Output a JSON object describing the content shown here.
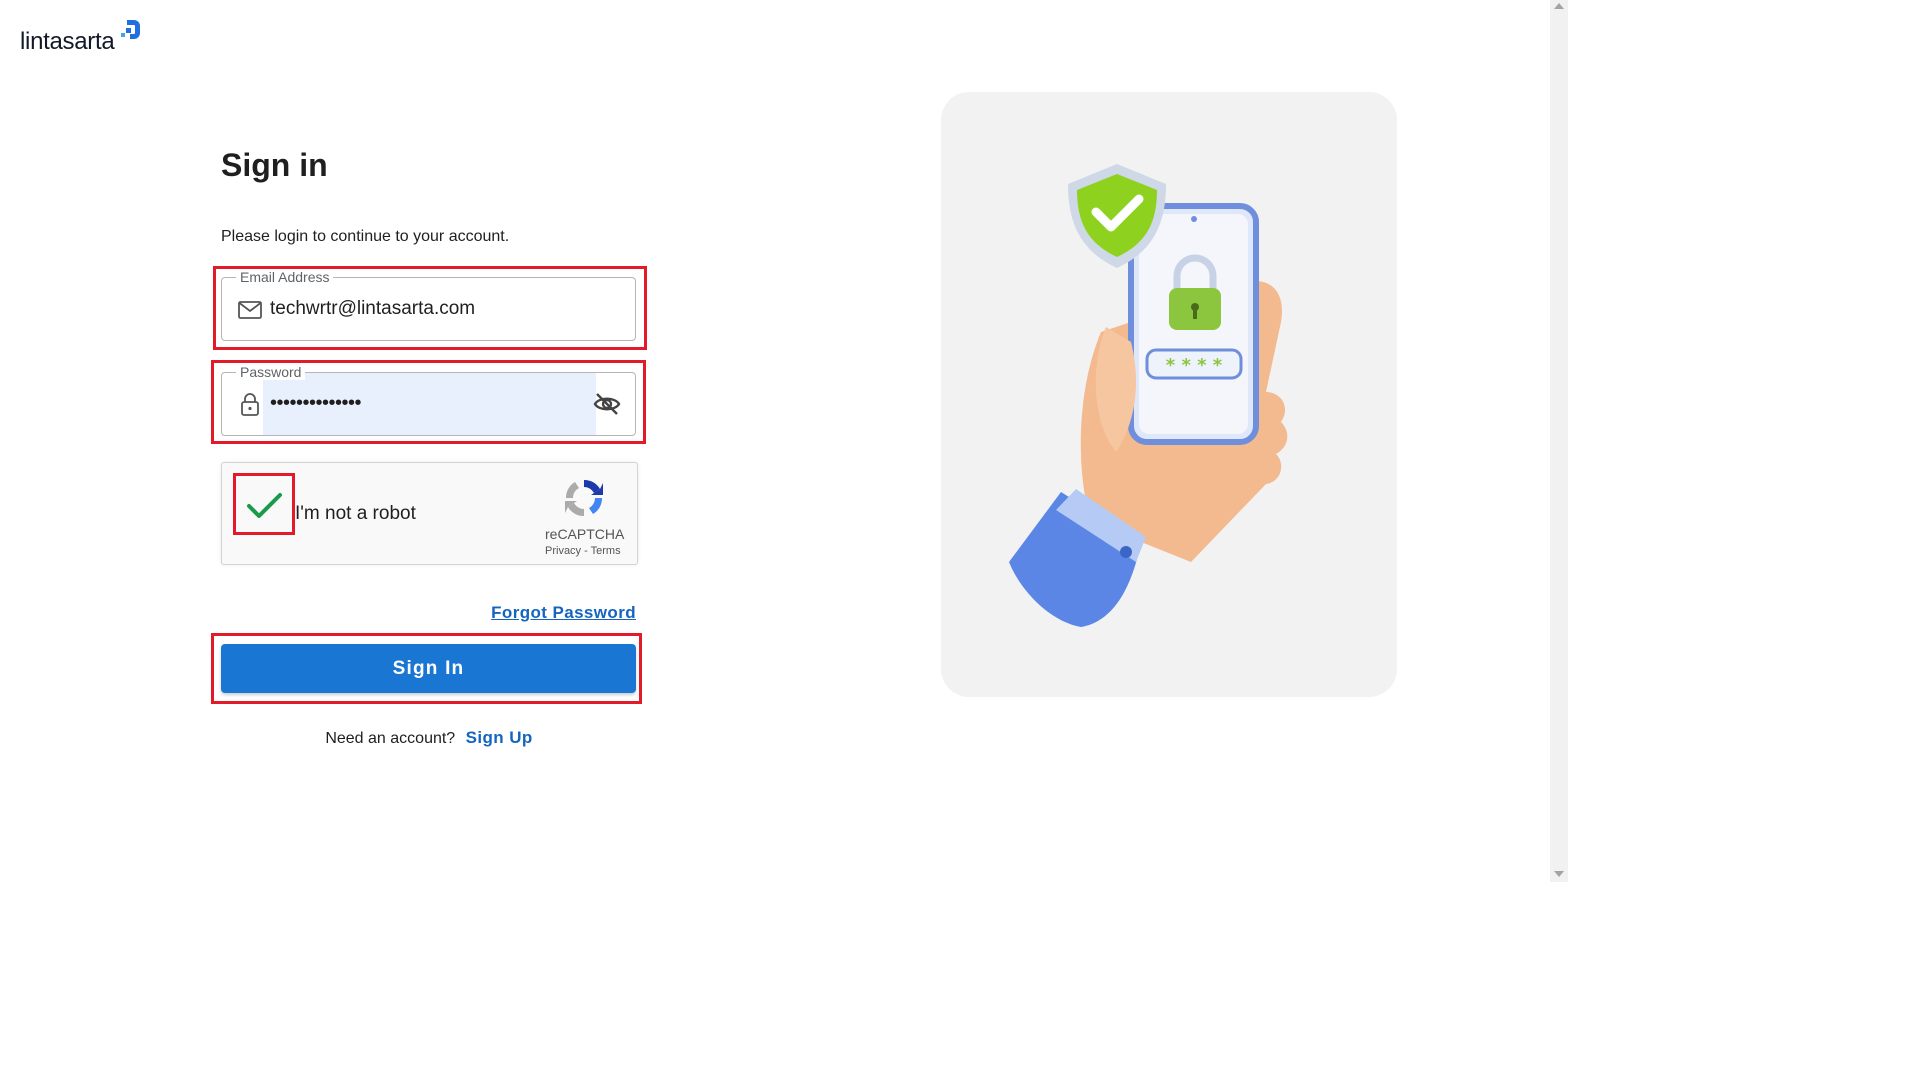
{
  "brand": {
    "name": "lintasarta",
    "mark_color": "#1e6fe0"
  },
  "page": {
    "title": "Sign in",
    "subtitle": "Please login to continue to your account."
  },
  "email": {
    "label": "Email Address",
    "value": "techwrtr@lintasarta.com",
    "icon": "mail-icon"
  },
  "password": {
    "label": "Password",
    "masked_value": "••••••••••••••",
    "icon": "lock-icon",
    "toggle_icon": "eye-off-icon",
    "autofill_color": "#e8f0fe"
  },
  "captcha": {
    "label": "I'm not a robot",
    "checked": true,
    "brand": "reCAPTCHA",
    "privacy": "Privacy",
    "separator": " - ",
    "terms": "Terms"
  },
  "links": {
    "forgot_password": "Forgot Password",
    "need_account": "Need an account?",
    "sign_up": "Sign Up"
  },
  "buttons": {
    "sign_in": "Sign In"
  },
  "colors": {
    "primary": "#1976d2",
    "link": "#1565c0",
    "highlight": "#e21b2b",
    "check": "#1a9a4a"
  }
}
